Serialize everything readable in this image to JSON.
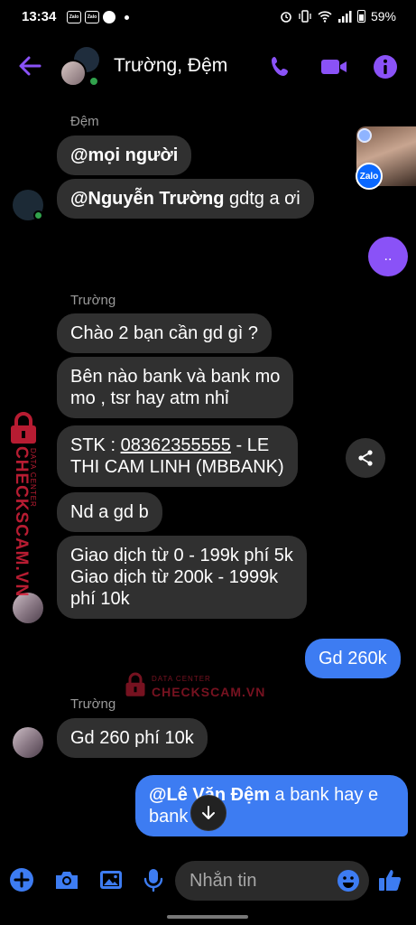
{
  "status_bar": {
    "time": "13:34",
    "app1": "Zalo",
    "app2": "Zalo",
    "battery": "59%"
  },
  "header": {
    "title": "Trường, Đệm"
  },
  "messages": [
    {
      "sender": "Đệm"
    },
    {
      "text": "@mọi người"
    },
    {
      "mention": "@Nguyễn Trường",
      "text": " gdtg a ơi"
    },
    {
      "typing": ".."
    },
    {
      "sender": "Trường"
    },
    {
      "text": "Chào 2 bạn cần gd gì ?"
    },
    {
      "line1": "Bên nào bank và bank mo",
      "line2": "mo , tsr hay atm nhỉ"
    },
    {
      "prefix": "STK : ",
      "account": "08362355555",
      "suffix": " - LE",
      "line2": "THI CAM LINH (MBBANK)"
    },
    {
      "text": "Nd a gd b"
    },
    {
      "line1": "Giao dịch từ 0 - 199k phí 5k",
      "line2": "Giao dịch từ 200k - 1999k",
      "line3": "phí 10k"
    },
    {
      "text": "Gd 260k"
    },
    {
      "sender": "Trường"
    },
    {
      "text": "Gd 260 phí 10k"
    },
    {
      "mention": "@Lê Văn Đệm",
      "text": " a bank hay e",
      "line2": "bank"
    }
  ],
  "zalo_badge": "Zalo",
  "watermark": {
    "brand": "CHECKSCAM.VN",
    "sub": "DATA CENTER"
  },
  "composer": {
    "placeholder": "Nhắn tin"
  },
  "colors": {
    "accent": "#8a52f7",
    "my_bubble": "#3d7cf2",
    "their_bubble": "#303030",
    "watermark": "#d7223b"
  }
}
